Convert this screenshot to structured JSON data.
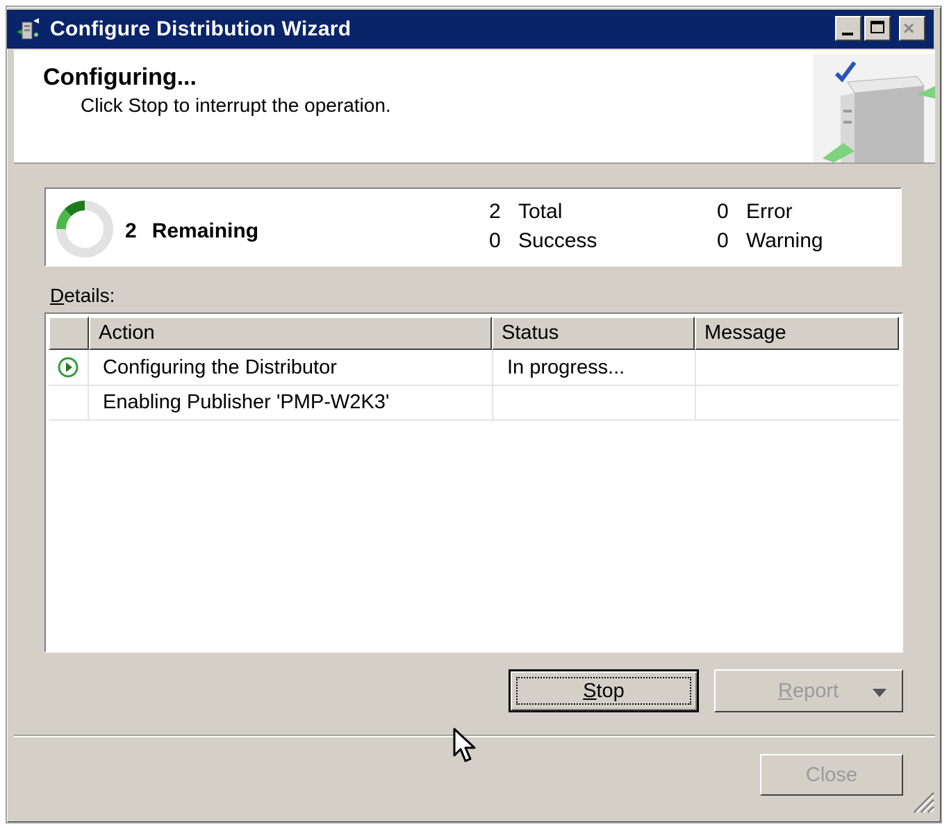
{
  "window": {
    "title": "Configure Distribution Wizard",
    "controls": {
      "minimize": "minimize-icon",
      "maximize": "maximize-icon",
      "close_glyph": "×"
    }
  },
  "header": {
    "title": "Configuring...",
    "subtitle": "Click Stop to interrupt the operation."
  },
  "summary": {
    "remaining_count": "2",
    "remaining_label": "Remaining",
    "total_count": "2",
    "total_label": "Total",
    "success_count": "0",
    "success_label": "Success",
    "error_count": "0",
    "error_label": "Error",
    "warning_count": "0",
    "warning_label": "Warning"
  },
  "details": {
    "label_first": "D",
    "label_rest": "etails:",
    "columns": [
      "",
      "Action",
      "Status",
      "Message"
    ],
    "rows": [
      {
        "icon": "in-progress-icon",
        "action": "Configuring the Distributor",
        "status": "In progress...",
        "message": ""
      },
      {
        "icon": "",
        "action": "Enabling Publisher 'PMP-W2K3'",
        "status": "",
        "message": ""
      }
    ]
  },
  "buttons": {
    "stop_first": "S",
    "stop_rest": "top",
    "report_first": "R",
    "report_rest": "eport",
    "close": "Close"
  },
  "colors": {
    "titlebar": "#0a246a",
    "face": "#d4d0c8",
    "accent_green": "#2f9e3a"
  }
}
